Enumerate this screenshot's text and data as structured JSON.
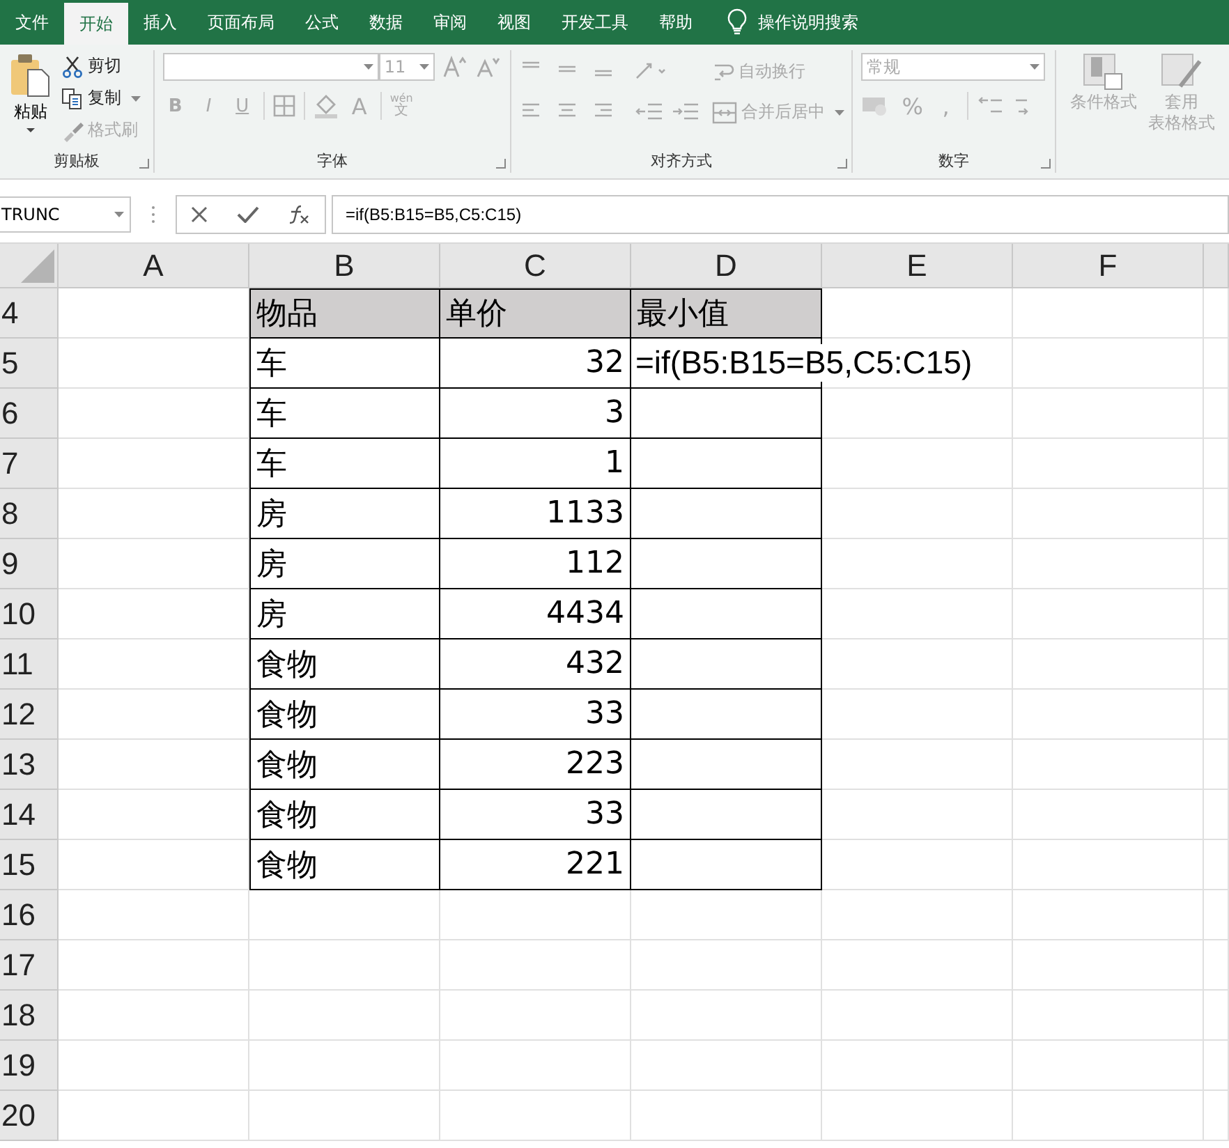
{
  "tabs": [
    {
      "label": "文件",
      "selected": false
    },
    {
      "label": "开始",
      "selected": true
    },
    {
      "label": "插入",
      "selected": false
    },
    {
      "label": "页面布局",
      "selected": false
    },
    {
      "label": "公式",
      "selected": false
    },
    {
      "label": "数据",
      "selected": false
    },
    {
      "label": "审阅",
      "selected": false
    },
    {
      "label": "视图",
      "selected": false
    },
    {
      "label": "开发工具",
      "selected": false
    },
    {
      "label": "帮助",
      "selected": false
    }
  ],
  "tell_me": "操作说明搜索",
  "ribbon": {
    "clipboard": {
      "label": "剪贴板",
      "paste": "粘贴",
      "cut": {
        "label": "剪切",
        "disabled": false
      },
      "copy": {
        "label": "复制",
        "disabled": false
      },
      "painter": {
        "label": "格式刷",
        "disabled": true
      }
    },
    "font": {
      "label": "字体",
      "size": "11",
      "bold": "B",
      "italic": "I",
      "underline": "U",
      "font_color": "A",
      "phonetic_top": "wén",
      "phonetic_bottom": "文",
      "disabled": true
    },
    "alignment": {
      "label": "对齐方式",
      "wrap": "自动换行",
      "merge": "合并后居中",
      "disabled": true
    },
    "number": {
      "label": "数字",
      "format": "常规",
      "percent": "%",
      "comma": ",",
      "disabled": true
    },
    "styles": {
      "conditional": "条件格式",
      "table_top": "套用",
      "table_bottom": "表格格式",
      "disabled": true
    }
  },
  "name_box": "TRUNC",
  "formula": "=if(B5:B15=B5,C5:C15)",
  "columns": [
    "A",
    "B",
    "C",
    "D",
    "E",
    "F"
  ],
  "rows": [
    {
      "number": "4",
      "kind": "header",
      "cells": {
        "B": {
          "text": "物品",
          "kind": "text"
        },
        "C": {
          "text": "单价",
          "kind": "text"
        },
        "D": {
          "text": "最小值",
          "kind": "text"
        }
      }
    },
    {
      "number": "5",
      "kind": "data",
      "cells": {
        "B": {
          "text": "车",
          "kind": "text"
        },
        "C": {
          "text": "32",
          "kind": "number"
        },
        "D": {
          "text": "=if(B5:B15=B5,C5:C15)",
          "kind": "editing"
        }
      }
    },
    {
      "number": "6",
      "kind": "data",
      "cells": {
        "B": {
          "text": "车",
          "kind": "text"
        },
        "C": {
          "text": "3",
          "kind": "number"
        }
      }
    },
    {
      "number": "7",
      "kind": "data",
      "cells": {
        "B": {
          "text": "车",
          "kind": "text"
        },
        "C": {
          "text": "1",
          "kind": "number"
        }
      }
    },
    {
      "number": "8",
      "kind": "data",
      "cells": {
        "B": {
          "text": "房",
          "kind": "text"
        },
        "C": {
          "text": "1133",
          "kind": "number"
        }
      }
    },
    {
      "number": "9",
      "kind": "data",
      "cells": {
        "B": {
          "text": "房",
          "kind": "text"
        },
        "C": {
          "text": "112",
          "kind": "number"
        }
      }
    },
    {
      "number": "10",
      "kind": "data",
      "cells": {
        "B": {
          "text": "房",
          "kind": "text"
        },
        "C": {
          "text": "4434",
          "kind": "number"
        }
      }
    },
    {
      "number": "11",
      "kind": "data",
      "cells": {
        "B": {
          "text": "食物",
          "kind": "text"
        },
        "C": {
          "text": "432",
          "kind": "number"
        }
      }
    },
    {
      "number": "12",
      "kind": "data",
      "cells": {
        "B": {
          "text": "食物",
          "kind": "text"
        },
        "C": {
          "text": "33",
          "kind": "number"
        }
      }
    },
    {
      "number": "13",
      "kind": "data",
      "cells": {
        "B": {
          "text": "食物",
          "kind": "text"
        },
        "C": {
          "text": "223",
          "kind": "number"
        }
      }
    },
    {
      "number": "14",
      "kind": "data",
      "cells": {
        "B": {
          "text": "食物",
          "kind": "text"
        },
        "C": {
          "text": "33",
          "kind": "number"
        }
      }
    },
    {
      "number": "15",
      "kind": "data",
      "cells": {
        "B": {
          "text": "食物",
          "kind": "text"
        },
        "C": {
          "text": "221",
          "kind": "number"
        }
      }
    },
    {
      "number": "16",
      "kind": "blank",
      "cells": {}
    },
    {
      "number": "17",
      "kind": "blank",
      "cells": {}
    },
    {
      "number": "18",
      "kind": "blank",
      "cells": {}
    },
    {
      "number": "19",
      "kind": "blank",
      "cells": {}
    },
    {
      "number": "20",
      "kind": "blank",
      "cells": {}
    }
  ]
}
